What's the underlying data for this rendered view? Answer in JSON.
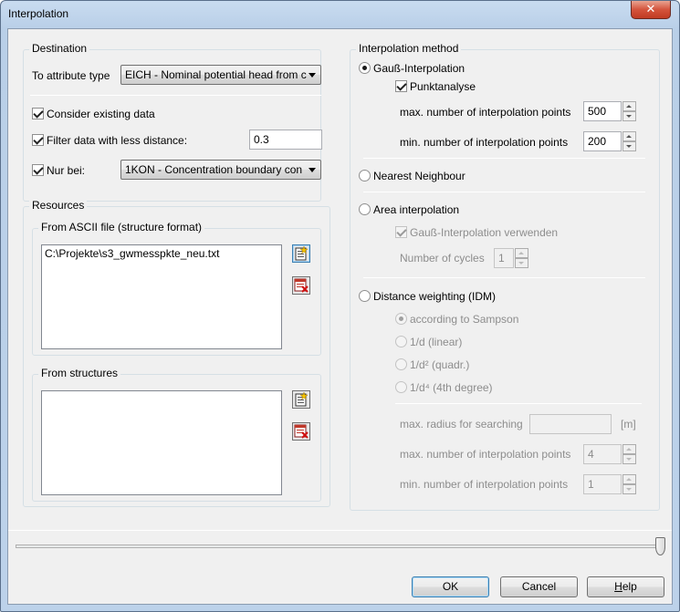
{
  "window": {
    "title": "Interpolation",
    "close_glyph": "✕"
  },
  "destination": {
    "title": "Destination",
    "attribute_label": "To attribute type",
    "attribute_value": "EICH - Nominal potential head from c",
    "consider_existing": {
      "label": "Consider existing data",
      "checked": true
    },
    "filter_less_distance": {
      "label": "Filter data with less distance:",
      "checked": true,
      "value": "0.3"
    },
    "nur_bei": {
      "label": "Nur bei:",
      "checked": true,
      "value": "1KON - Concentration boundary con"
    }
  },
  "resources": {
    "title": "Resources",
    "ascii": {
      "title": "From ASCII file (structure format)",
      "files": [
        "C:\\Projekte\\s3_gwmesspkte_neu.txt"
      ]
    },
    "structures": {
      "title": "From structures",
      "items": []
    }
  },
  "method": {
    "title": "Interpolation method",
    "gauss": {
      "label": "Gauß-Interpolation",
      "selected": true,
      "punktanalyse": {
        "label": "Punktanalyse",
        "checked": true
      },
      "max_points": {
        "label": "max. number of interpolation points",
        "value": "500"
      },
      "min_points": {
        "label": "min. number of interpolation points",
        "value": "200"
      }
    },
    "nearest": {
      "label": "Nearest Neighbour",
      "selected": false
    },
    "area": {
      "label": "Area interpolation",
      "selected": false,
      "use_gauss": {
        "label": "Gauß-Interpolation verwenden",
        "checked": true
      },
      "cycles": {
        "label": "Number of cycles",
        "value": "1"
      }
    },
    "idw": {
      "label": "Distance weighting (IDM)",
      "selected": false,
      "options": [
        {
          "label": "according to Sampson",
          "selected": true
        },
        {
          "label": "1/d  (linear)",
          "selected": false
        },
        {
          "label": "1/d² (quadr.)",
          "selected": false
        },
        {
          "label": "1/d⁴ (4th degree)",
          "selected": false
        }
      ],
      "radius": {
        "label": "max. radius for searching",
        "value": "",
        "unit": "[m]"
      },
      "max_points": {
        "label": "max. number of interpolation points",
        "value": "4"
      },
      "min_points": {
        "label": "min. number of interpolation points",
        "value": "1"
      }
    }
  },
  "footer": {
    "slider_value": 1.0,
    "ok": "OK",
    "cancel": "Cancel",
    "help_first": "H",
    "help_rest": "elp"
  },
  "icons": {
    "add": "add-file-icon",
    "delete": "delete-file-icon"
  }
}
